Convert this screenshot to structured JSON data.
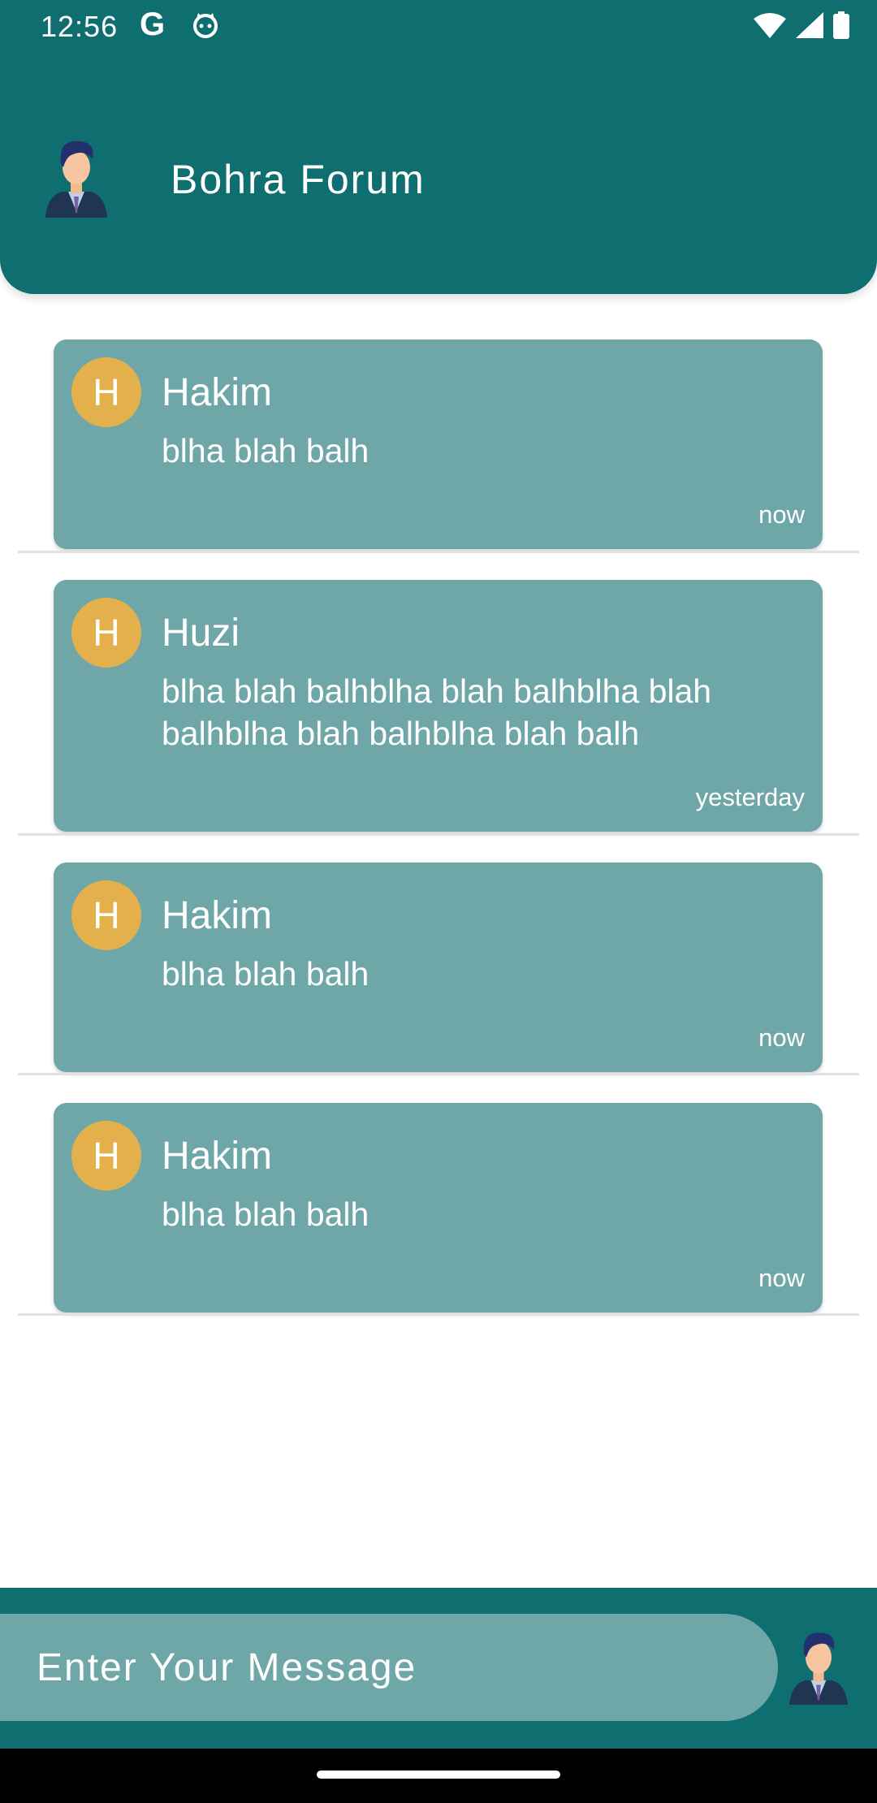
{
  "status_bar": {
    "time": "12:56",
    "google_icon": "G"
  },
  "app_bar": {
    "title": "Bohra Forum",
    "logo_icon": "person-avatar-icon"
  },
  "messages": [
    {
      "initial": "H",
      "sender": "Hakim",
      "text": "blha blah balh",
      "time": "now"
    },
    {
      "initial": "H",
      "sender": "Huzi",
      "text": "blha blah balhblha blah balhblha blah balhblha blah balhblha blah balh",
      "time": "yesterday"
    },
    {
      "initial": "H",
      "sender": "Hakim",
      "text": "blha blah balh",
      "time": "now"
    },
    {
      "initial": "H",
      "sender": "Hakim",
      "text": "blha blah balh",
      "time": "now"
    }
  ],
  "composer": {
    "placeholder": "Enter Your Message"
  },
  "colors": {
    "primary": "#0e6e70",
    "card": "#6fa7a8",
    "avatar": "#e4b04b"
  }
}
